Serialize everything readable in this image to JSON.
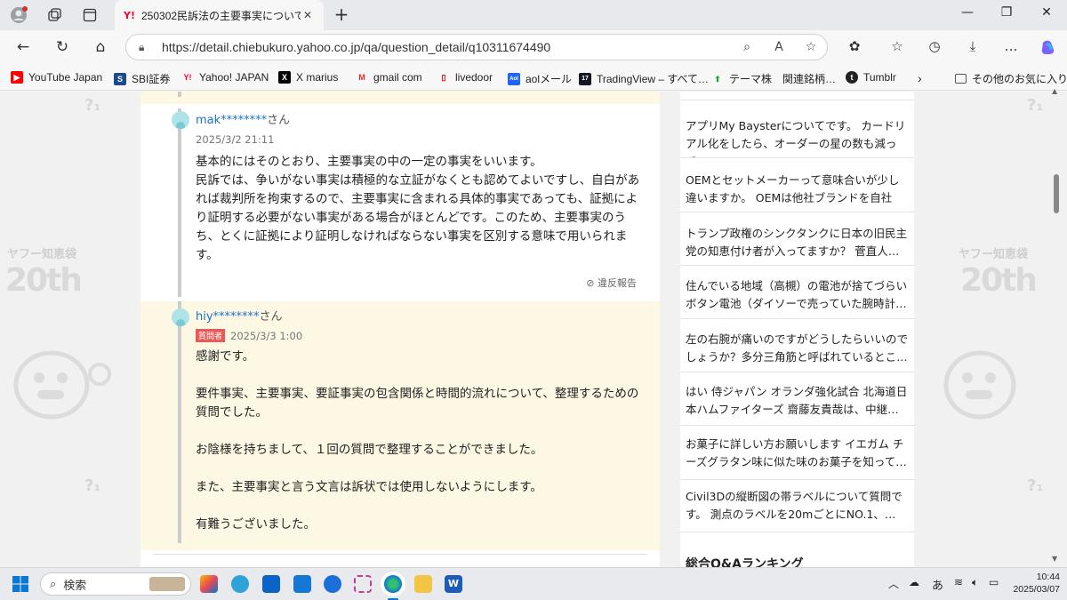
{
  "browser": {
    "tab_title": "250302民訴法の主要事実について…",
    "tab_favicon": "Y!",
    "url": "https://detail.chiebukuro.yahoo.co.jp/qa/question_detail/q10311674490"
  },
  "bookmarks": [
    {
      "label": "YouTube Japan",
      "icon": "youtube-icon",
      "color": "#ff0000"
    },
    {
      "label": "SBI証券",
      "icon": "sbi-icon",
      "color": "#1a4b8c"
    },
    {
      "label": "Yahoo! JAPAN",
      "icon": "yahoo-icon",
      "color": "#ff0033"
    },
    {
      "label": "X marius",
      "icon": "x-icon",
      "color": "#000000"
    },
    {
      "label": "gmail com",
      "icon": "gmail-icon",
      "color": "#d93025"
    },
    {
      "label": "livedoor",
      "icon": "livedoor-icon",
      "color": "#cc0000"
    },
    {
      "label": "aolメール",
      "icon": "aol-icon",
      "color": "#2164f3"
    },
    {
      "label": "TradingView – すべて…",
      "icon": "tradingview-icon",
      "color": "#131722"
    },
    {
      "label": "テーマ株　関連銘柄…",
      "icon": "kabutan-icon",
      "color": "#25a84a"
    },
    {
      "label": "Tumblr",
      "icon": "tumblr-icon",
      "color": "#222222"
    },
    {
      "label": "その他のお気に入り",
      "icon": "folder-icon",
      "color": "#555555"
    }
  ],
  "answers": [
    {
      "user": "mak********",
      "suffix": "さん",
      "date": "2025/3/2 21:11",
      "badge": "",
      "body": "基本的にはそのとおり、主要事実の中の一定の事実をいいます。\n民訴では、争いがない事実は積極的な立証がなくとも認めてよいですし、自白があれば裁判所を拘束するので、主要事実に含まれる具体的事実であっても、証拠により証明する必要がない事実がある場合がほとんどです。このため、主要事実のうち、とくに証拠により証明しなければならない事実を区別する意味で用いられます。",
      "report": "違反報告"
    },
    {
      "user": "hiy********",
      "suffix": "さん",
      "date": "2025/3/3 1:00",
      "badge": "質問者",
      "body": "感謝です。\n\n要件事実、主要事実、要証事実の包含関係と時間的流れについて、整理するための質問でした。\n\nお陰様を持ちまして、１回の質問で整理することができました。\n\nまた、主要事実と言う文言は訴状では使用しないようにします。\n\n有難うございました。"
    }
  ],
  "sidebar": {
    "items": [
      "アプリMy Baysterについてです。 カードリアル化をしたら、オーダーの星の数も減って…",
      "OEMとセットメーカーって意味合いが少し違いますか。 OEMは他社ブランドを自社で…",
      "トランプ政権のシンクタンクに日本の旧民主党の知恵付け者が入ってますか？ 菅直人…",
      "住んでいる地域（高槻）の電池が捨てづらいボタン電池（ダイソーで売っていた腕時計…",
      "左の右腕が痛いのですがどうしたらいいのでしょうか？多分三角筋と呼ばれているとこ…",
      "はい 侍ジャパン オランダ強化試合 北海道日本ハムファイターズ 齋藤友貴哉は、中継…",
      "お菓子に詳しい方お願いします イエガム チーズグラタン味に似た味のお菓子を知って…",
      "Civil3Dの縦断図の帯ラベルについて質問です。 測点のラベルを20mごとにNO.1、…"
    ],
    "heading": "総合Q&Aランキング"
  },
  "decor": {
    "left_text": "ヤフー知恵袋",
    "left_big": "20th"
  },
  "taskbar": {
    "search_placeholder": "検索",
    "ime": "あ",
    "time": "10:44",
    "date": "2025/03/07"
  }
}
